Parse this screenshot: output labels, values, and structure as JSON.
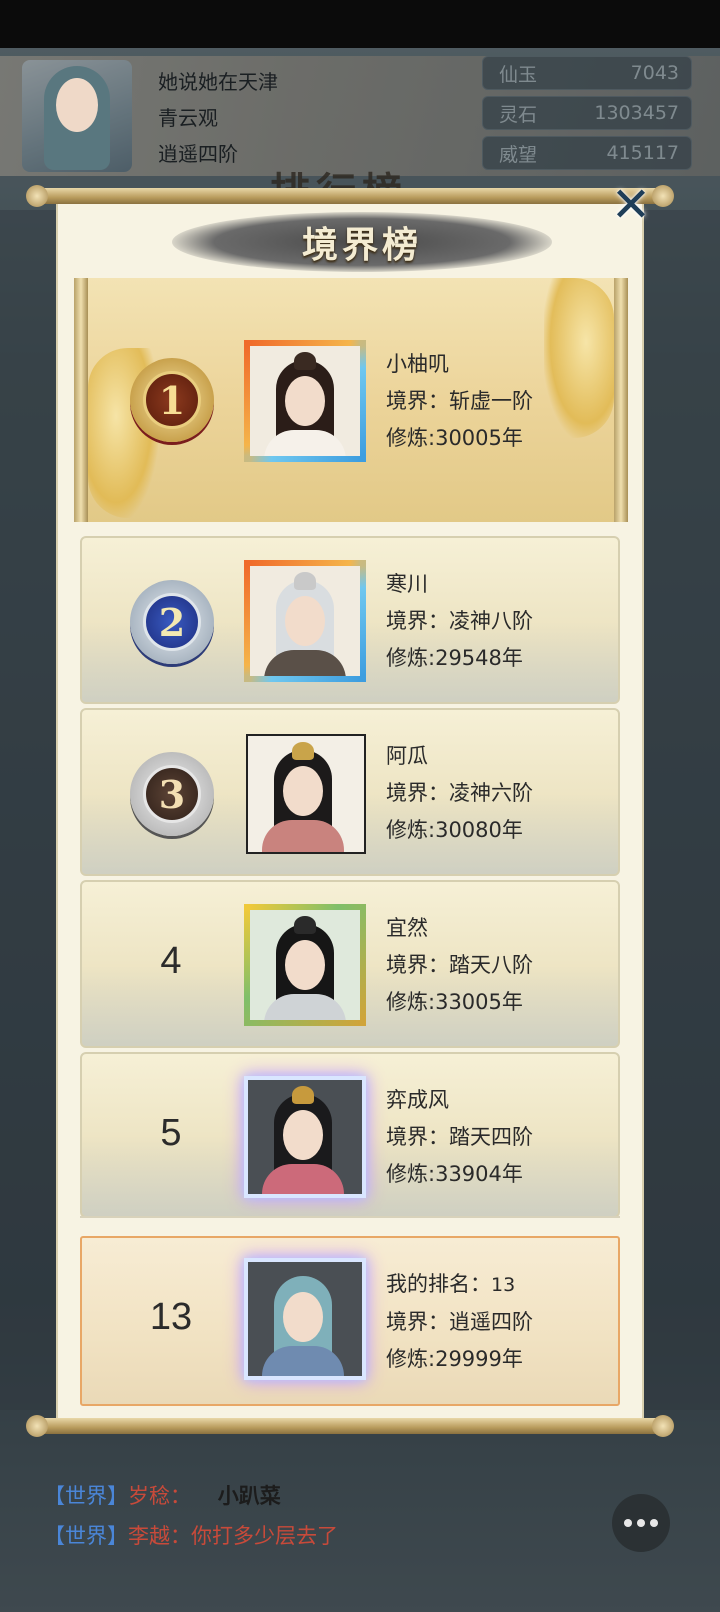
{
  "background": {
    "player": {
      "name": "她说她在天津",
      "sect": "青云观",
      "realm": "逍遥四阶"
    },
    "resources": [
      {
        "label": "仙玉",
        "value": "7043"
      },
      {
        "label": "灵石",
        "value": "1303457"
      },
      {
        "label": "威望",
        "value": "415117"
      }
    ],
    "screen_title": "排行榜",
    "chat": [
      {
        "tag": "【世界】",
        "name": "岁稔：",
        "message": "小趴菜"
      },
      {
        "tag": "【世界】",
        "name": "李越：",
        "message": "你打多少层去了"
      }
    ]
  },
  "dialog": {
    "title": "境界榜",
    "close_icon": "close-x-icon",
    "rows": [
      {
        "rank": "1",
        "name": "小柚叽",
        "realm_label": "境界：",
        "realm": "斩虚一阶",
        "cultivation_label": "修炼:",
        "cultivation": "30005年",
        "medal": "gold",
        "frame": "fire"
      },
      {
        "rank": "2",
        "name": "寒川",
        "realm_label": "境界：",
        "realm": "凌神八阶",
        "cultivation_label": "修炼:",
        "cultivation": "29548年",
        "medal": "blue",
        "frame": "fire"
      },
      {
        "rank": "3",
        "name": "阿瓜",
        "realm_label": "境界：",
        "realm": "凌神六阶",
        "cultivation_label": "修炼:",
        "cultivation": "30080年",
        "medal": "silver",
        "frame": "plain"
      },
      {
        "rank": "4",
        "name": "宜然",
        "realm_label": "境界：",
        "realm": "踏天八阶",
        "cultivation_label": "修炼:",
        "cultivation": "33005年",
        "medal": "none",
        "frame": "gold"
      },
      {
        "rank": "5",
        "name": "弈成风",
        "realm_label": "境界：",
        "realm": "踏天四阶",
        "cultivation_label": "修炼:",
        "cultivation": "33904年",
        "medal": "none",
        "frame": "ink"
      }
    ],
    "my_rank": {
      "rank": "13",
      "label": "我的排名：",
      "rank_text": "13",
      "realm_label": "境界：",
      "realm": "逍遥四阶",
      "cultivation_label": "修炼:",
      "cultivation": "29999年"
    }
  }
}
